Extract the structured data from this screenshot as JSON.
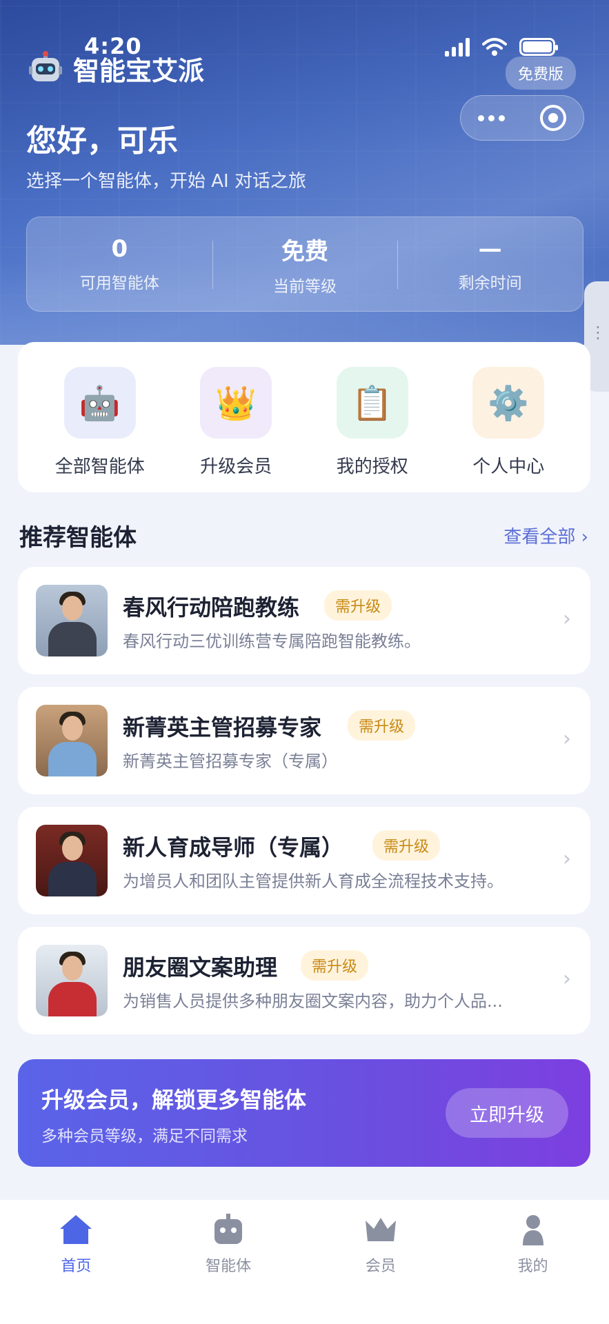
{
  "status_bar": {
    "time": "4:20"
  },
  "header": {
    "app_name": "智能宝艾派",
    "version_badge": "免费版",
    "greeting": "您好，可乐",
    "subtitle": "选择一个智能体，开始 AI 对话之旅",
    "stats": [
      {
        "value": "0",
        "label": "可用智能体"
      },
      {
        "value": "免费",
        "label": "当前等级"
      },
      {
        "value": "—",
        "label": "剩余时间"
      }
    ]
  },
  "quick_actions": [
    {
      "label": "全部智能体",
      "icon": "robot-icon",
      "glyph": "🤖",
      "bg": "#e9ecfb"
    },
    {
      "label": "升级会员",
      "icon": "crown-icon",
      "glyph": "👑",
      "bg": "#f1eafb"
    },
    {
      "label": "我的授权",
      "icon": "clipboard-icon",
      "glyph": "📋",
      "bg": "#e4f6ee"
    },
    {
      "label": "个人中心",
      "icon": "gear-icon",
      "glyph": "⚙️",
      "bg": "#fdf1e2"
    }
  ],
  "recommend": {
    "title": "推荐智能体",
    "view_all": "查看全部 ›",
    "agents": [
      {
        "name": "春风行动陪跑教练",
        "tag": "需升级",
        "desc": "春风行动三优训练营专属陪跑智能教练。"
      },
      {
        "name": "新菁英主管招募专家",
        "tag": "需升级",
        "desc": "新菁英主管招募专家（专属）"
      },
      {
        "name": "新人育成导师（专属）",
        "tag": "需升级",
        "desc": "为增员人和团队主管提供新人育成全流程技术支持。"
      },
      {
        "name": "朋友圈文案助理",
        "tag": "需升级",
        "desc": "为销售人员提供多种朋友圈文案内容，助力个人品..."
      }
    ]
  },
  "banner": {
    "title": "升级会员，解锁更多智能体",
    "subtitle": "多种会员等级，满足不同需求",
    "button": "立即升级"
  },
  "tabbar": [
    {
      "label": "首页",
      "active": true
    },
    {
      "label": "智能体",
      "active": false
    },
    {
      "label": "会员",
      "active": false
    },
    {
      "label": "我的",
      "active": false
    }
  ],
  "colors": {
    "accent": "#4d66e6",
    "tag_bg": "#fff3dc",
    "tag_text": "#c88a14"
  }
}
